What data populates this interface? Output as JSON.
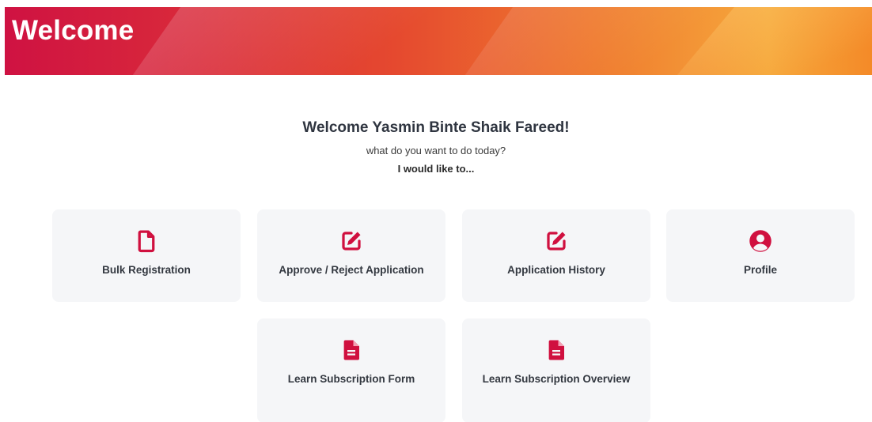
{
  "header": {
    "title": "Welcome"
  },
  "greeting": {
    "title": "Welcome Yasmin Binte Shaik Fareed!",
    "subtitle": "what do you want to do today?",
    "intent": "I would like to..."
  },
  "actions": [
    {
      "label": "Bulk Registration",
      "icon": "file-icon"
    },
    {
      "label": "Approve / Reject Application",
      "icon": "edit-icon"
    },
    {
      "label": "Application History",
      "icon": "edit-icon"
    },
    {
      "label": "Profile",
      "icon": "user-circle-icon"
    },
    {
      "label": "Learn Subscription Form",
      "icon": "file-text-icon"
    },
    {
      "label": "Learn Subscription Overview",
      "icon": "file-text-icon"
    }
  ],
  "colors": {
    "accent": "#d0103f",
    "card_bg": "#f5f6f8",
    "text_dark": "#333840"
  }
}
